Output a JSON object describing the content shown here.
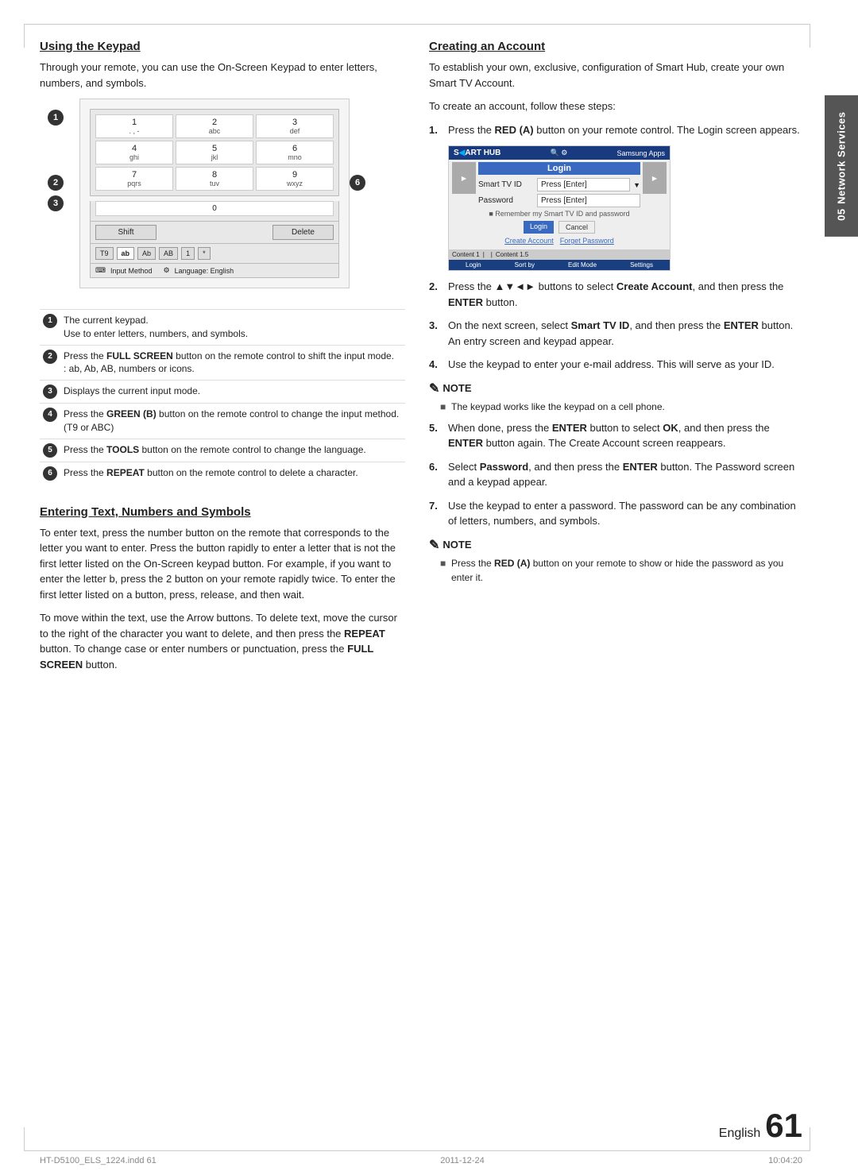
{
  "page": {
    "number": "61",
    "language_label": "English",
    "file_info": "HT-D5100_ELS_1224.indd   61",
    "date_info": "2011-12-24",
    "time_info": "10:04:20"
  },
  "side_tab": {
    "chapter_num": "05",
    "label": "Network Services"
  },
  "left_column": {
    "heading": "Using the Keypad",
    "intro": "Through your remote, you can use the On-Screen Keypad to enter letters, numbers, and symbols.",
    "keypad": {
      "rows": [
        [
          {
            "num": "1",
            "letters": ""
          },
          {
            "num": "2",
            "letters": "abc"
          },
          {
            "num": "3",
            "letters": "def"
          }
        ],
        [
          {
            "num": "4",
            "letters": "ghi"
          },
          {
            "num": "5",
            "letters": "jkl"
          },
          {
            "num": "6",
            "letters": "mno"
          }
        ],
        [
          {
            "num": "7",
            "letters": "pqrs"
          },
          {
            "num": "8",
            "letters": "tuv"
          },
          {
            "num": "9",
            "letters": "wxyz"
          }
        ]
      ],
      "zero": "0",
      "shift_label": "Shift",
      "delete_label": "Delete",
      "modes": [
        "T9",
        "ab",
        "Ab",
        "AB",
        "1",
        "*"
      ],
      "lang_input": "Input Method",
      "lang_setting": "Language: English"
    },
    "annotations": [
      {
        "num": "1",
        "text": "The current keypad.\nUse to enter letters, numbers, and symbols."
      },
      {
        "num": "2",
        "text": "Press the FULL SCREEN button on the remote control to shift the input mode.\n: ab, Ab, AB, numbers or icons."
      },
      {
        "num": "3",
        "text": "Displays the current input mode."
      },
      {
        "num": "4",
        "text": "Press the GREEN (B) button on the remote control to change the input method. (T9 or ABC)"
      },
      {
        "num": "5",
        "text": "Press the TOOLS button on the remote control to change the language."
      },
      {
        "num": "6",
        "text": "Press the REPEAT button on the remote control to delete a character."
      }
    ],
    "entering_text": {
      "heading": "Entering Text, Numbers and Symbols",
      "paragraphs": [
        "To enter text, press the number button on the remote that corresponds to the letter you want to enter. Press the button rapidly to enter a letter that is not the first letter listed on the On-Screen keypad button. For example, if you want to enter the letter b, press the 2 button on your remote rapidly twice. To enter the first letter listed on a button, press, release, and then wait.",
        "To move within the text, use the Arrow buttons. To delete text, move the cursor to the right of the character you want to delete, and then press the REPEAT button. To change case or enter numbers or punctuation, press the FULL SCREEN button."
      ]
    }
  },
  "right_column": {
    "creating_account": {
      "heading": "Creating an Account",
      "intro1": "To establish your own, exclusive, configuration of Smart Hub, create your own Smart TV Account.",
      "intro2": "To create an account, follow these steps:",
      "steps": [
        {
          "num": "1.",
          "text": "Press the RED (A) button on your remote control. The Login screen appears."
        },
        {
          "num": "2.",
          "text": "Press the ▲▼◄► buttons to select Create Account, and then press the ENTER button."
        },
        {
          "num": "3.",
          "text": "On the next screen, select Smart TV ID, and then press the ENTER button. An entry screen and keypad appear."
        },
        {
          "num": "4.",
          "text": "Use the keypad to enter your e-mail address. This will serve as your ID."
        }
      ],
      "note1": {
        "items": [
          "The keypad works like the keypad on a cell phone."
        ]
      },
      "steps2": [
        {
          "num": "5.",
          "text": "When done, press the ENTER button to select OK, and then press the ENTER button again. The Create Account screen reappears."
        },
        {
          "num": "6.",
          "text": "Select Password, and then press the ENTER button. The Password screen and a keypad appear."
        },
        {
          "num": "7.",
          "text": "Use the keypad to enter a password. The password can be any combination of letters, numbers, and symbols."
        }
      ],
      "note2": {
        "items": [
          "Press the RED (A) button on your remote to show or hide the password as you enter it."
        ]
      }
    },
    "login_screen": {
      "smart_hub_label": "SMART HUB",
      "login_title": "Login",
      "smart_tv_id_label": "Smart TV ID",
      "smart_tv_id_value": "Press [Enter]",
      "password_label": "Password",
      "password_value": "Press [Enter]",
      "remember_text": "■  Remember my Smart TV ID and password",
      "login_btn": "Login",
      "cancel_btn": "Cancel",
      "create_account_btn": "Create Account",
      "forgot_password_btn": "Forgot Password",
      "bottom_btns": [
        "Login",
        "Sort by",
        "Edit Mode",
        "Settings"
      ]
    }
  }
}
